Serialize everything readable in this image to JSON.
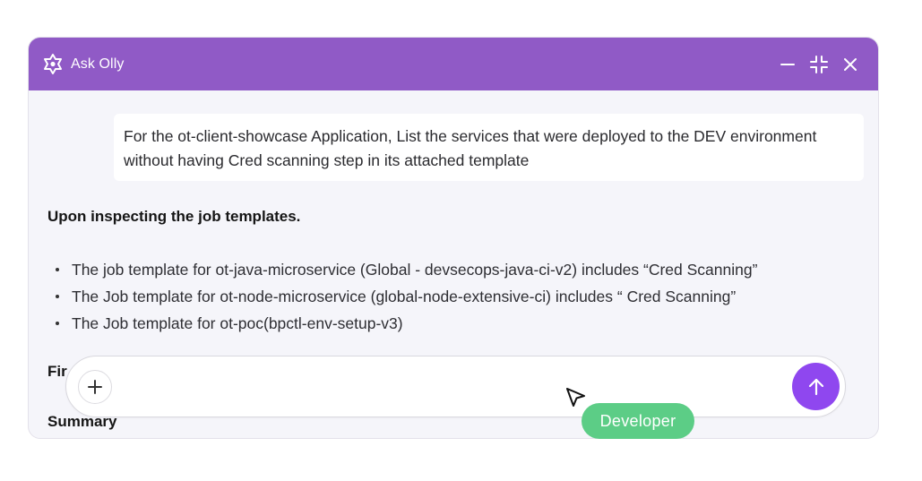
{
  "header": {
    "title": "Ask Olly",
    "logo_icon": "olly-flower-logo-icon",
    "controls": [
      "minimize-icon",
      "collapse-icon",
      "close-icon"
    ],
    "background": "#905ac6"
  },
  "conversation": {
    "user_message": "For the ot-client-showcase Application, List the services that were deployed to the DEV environment without having Cred scanning step in its attached template",
    "assistant": {
      "heading": "Upon inspecting the job templates.",
      "bullets": [
        "The job template for ot-java-microservice (Global - devsecops-java-ci-v2) includes “Cred Scanning”",
        "The Job template for ot-node-microservice (global-node-extensive-ci) includes “ Cred Scanning”",
        "The Job template for ot-poc(bpctl-env-setup-v3)"
      ],
      "partial_text": "Fir",
      "summary_heading": "Summary"
    }
  },
  "input": {
    "placeholder": "",
    "value": "",
    "attach_icon": "plus-icon",
    "send_icon": "arrow-up-icon",
    "send_color": "#8f47ef"
  },
  "cursor_label": {
    "text": "Developer",
    "color": "#5ccd86"
  }
}
